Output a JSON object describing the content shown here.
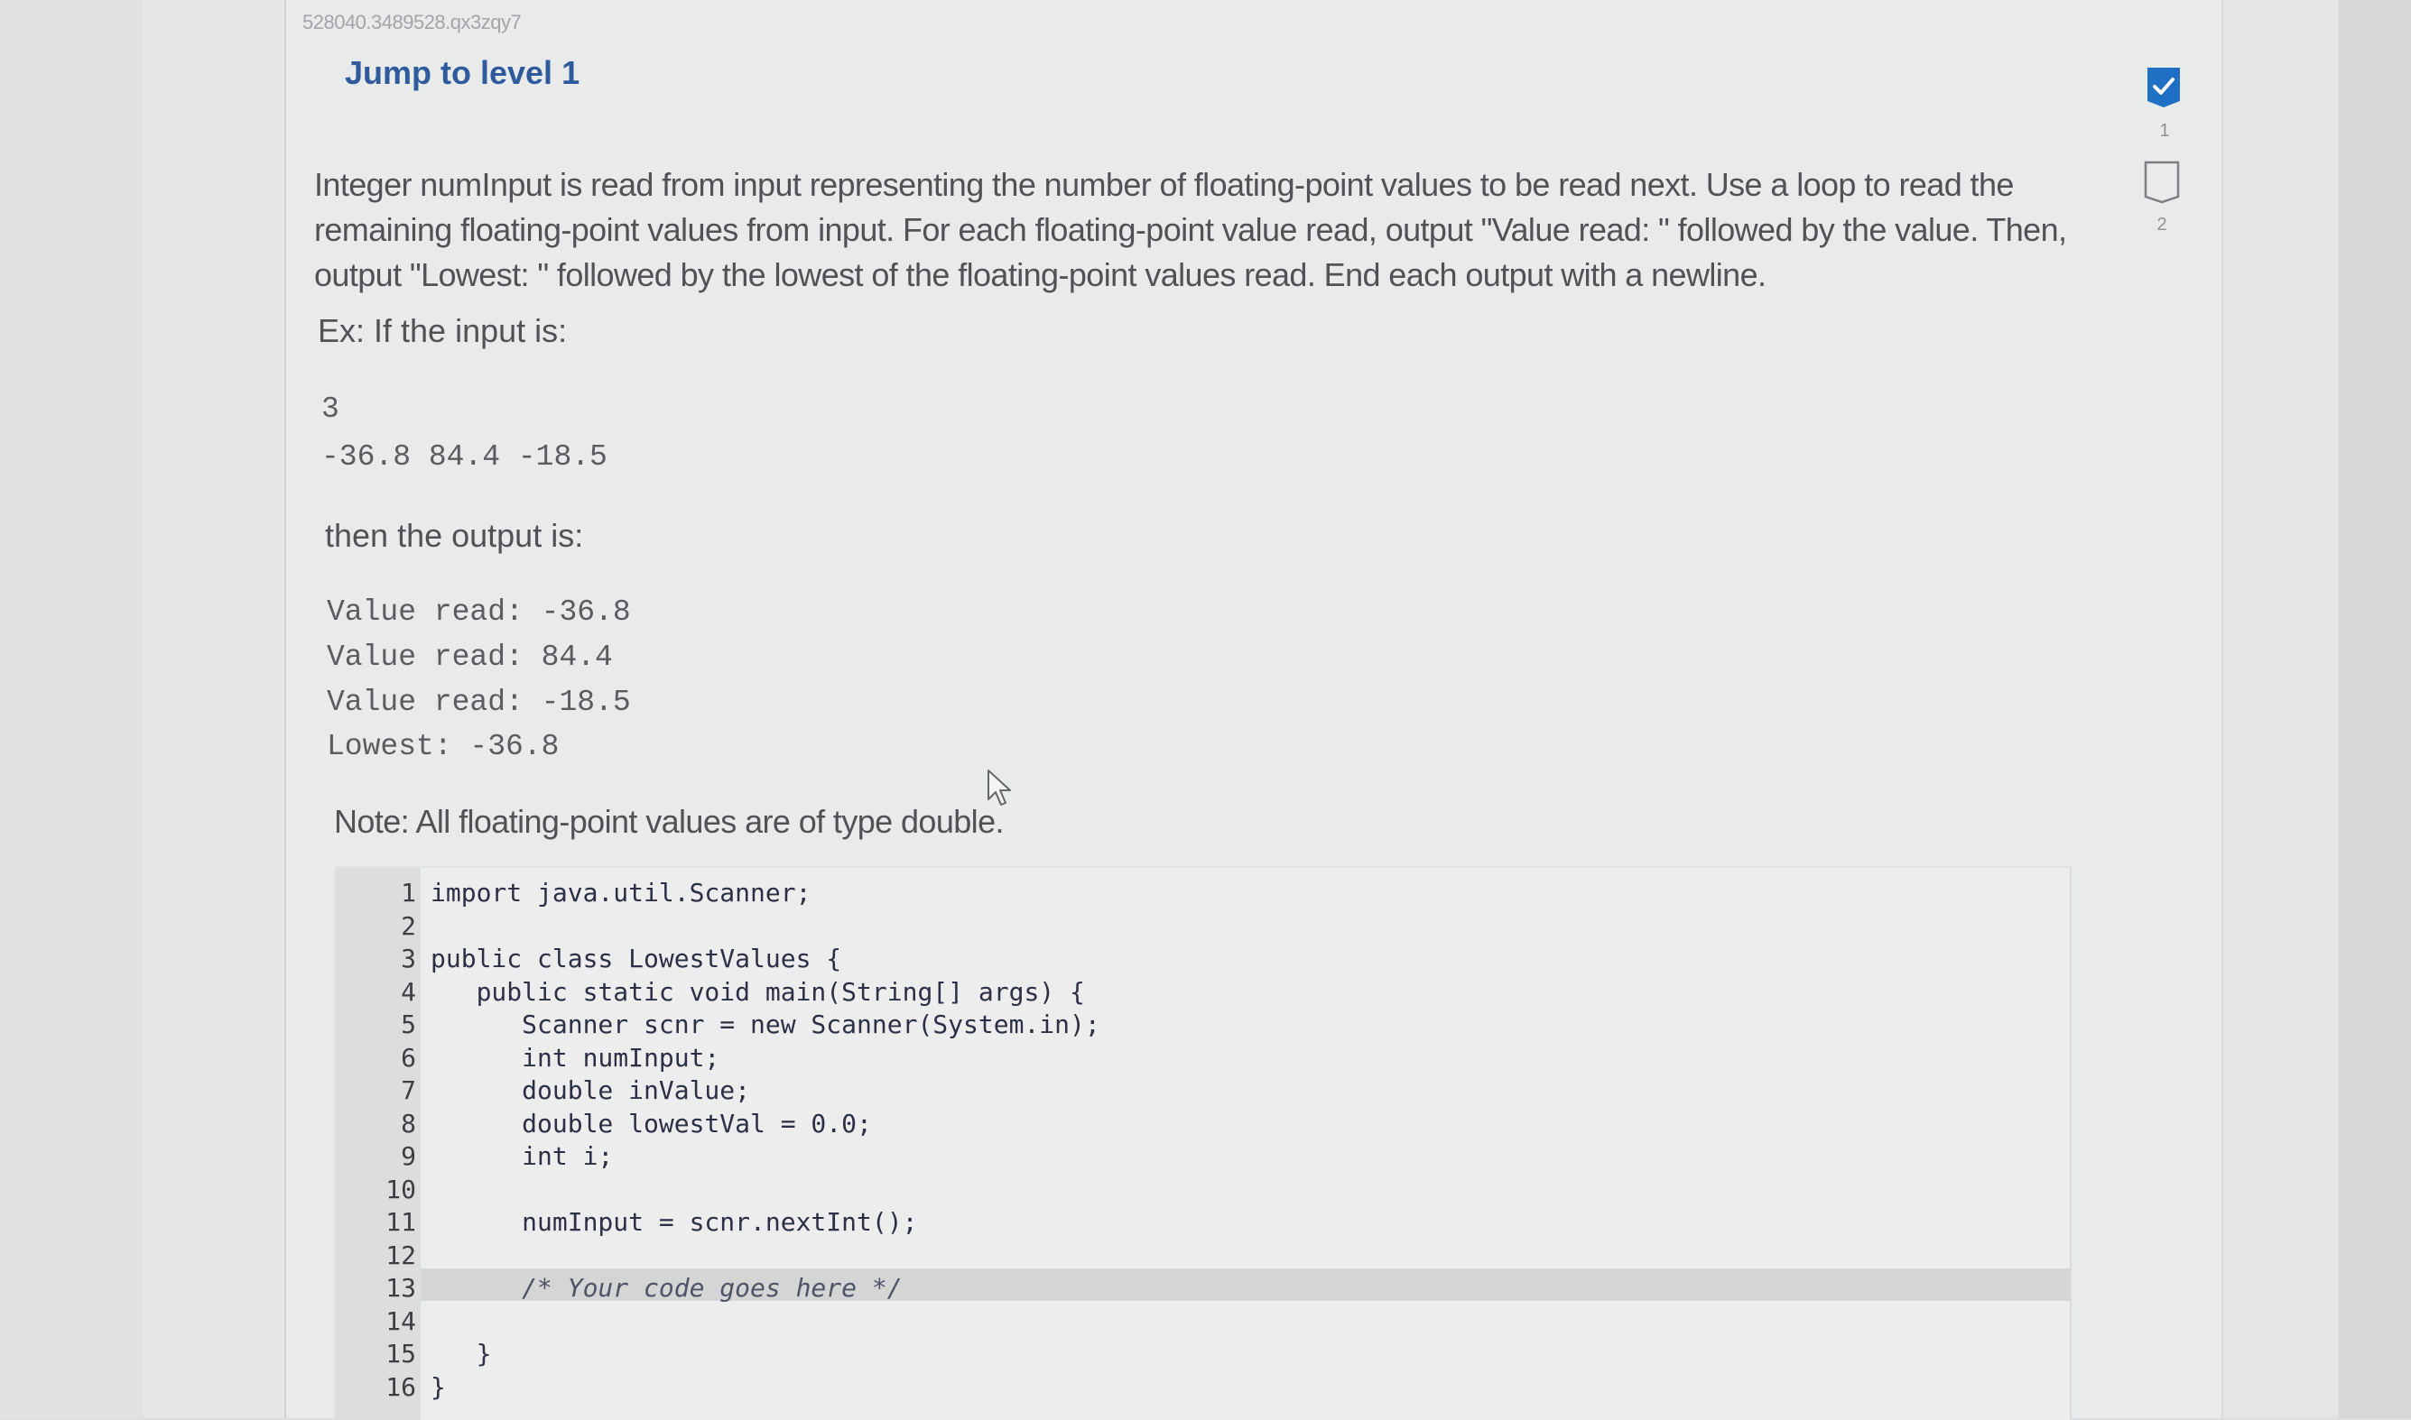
{
  "question_id": "528040.3489528.qx3zqy7",
  "heading": "Jump to level 1",
  "prompt": "Integer numInput is read from input representing the number of floating-point values to be read next. Use a loop to read the remaining floating-point values from input. For each floating-point value read, output \"Value read: \" followed by the value. Then, output \"Lowest: \" followed by the lowest of the floating-point values read. End each output with a newline.",
  "example": {
    "input_label": "Ex: If the input is:",
    "input_lines": [
      "3",
      "-36.8 84.4 -18.5"
    ],
    "output_label": "then the output is:",
    "output_lines": [
      "Value read: -36.8",
      "Value read: 84.4",
      "Value read: -18.5",
      "Lowest: -36.8"
    ]
  },
  "note": "Note: All floating-point values are of type double.",
  "editor": {
    "lines": [
      {
        "n": "1",
        "code": "import java.util.Scanner;"
      },
      {
        "n": "2",
        "code": ""
      },
      {
        "n": "3",
        "code": "public class LowestValues {"
      },
      {
        "n": "4",
        "code": "   public static void main(String[] args) {"
      },
      {
        "n": "5",
        "code": "      Scanner scnr = new Scanner(System.in);"
      },
      {
        "n": "6",
        "code": "      int numInput;"
      },
      {
        "n": "7",
        "code": "      double inValue;"
      },
      {
        "n": "8",
        "code": "      double lowestVal = 0.0;"
      },
      {
        "n": "9",
        "code": "      int i;"
      },
      {
        "n": "10",
        "code": ""
      },
      {
        "n": "11",
        "code": "      numInput = scnr.nextInt();"
      },
      {
        "n": "12",
        "code": ""
      },
      {
        "n": "13",
        "code": "      /* Your code goes here */"
      },
      {
        "n": "14",
        "code": ""
      },
      {
        "n": "15",
        "code": "   }"
      },
      {
        "n": "16",
        "code": "}"
      }
    ],
    "active_line": 13
  },
  "levels": [
    {
      "label": "1",
      "status": "completed"
    },
    {
      "label": "2",
      "status": "incomplete"
    }
  ],
  "colors": {
    "heading": "#2f5b9c",
    "level_done": "#1f6fc4"
  }
}
